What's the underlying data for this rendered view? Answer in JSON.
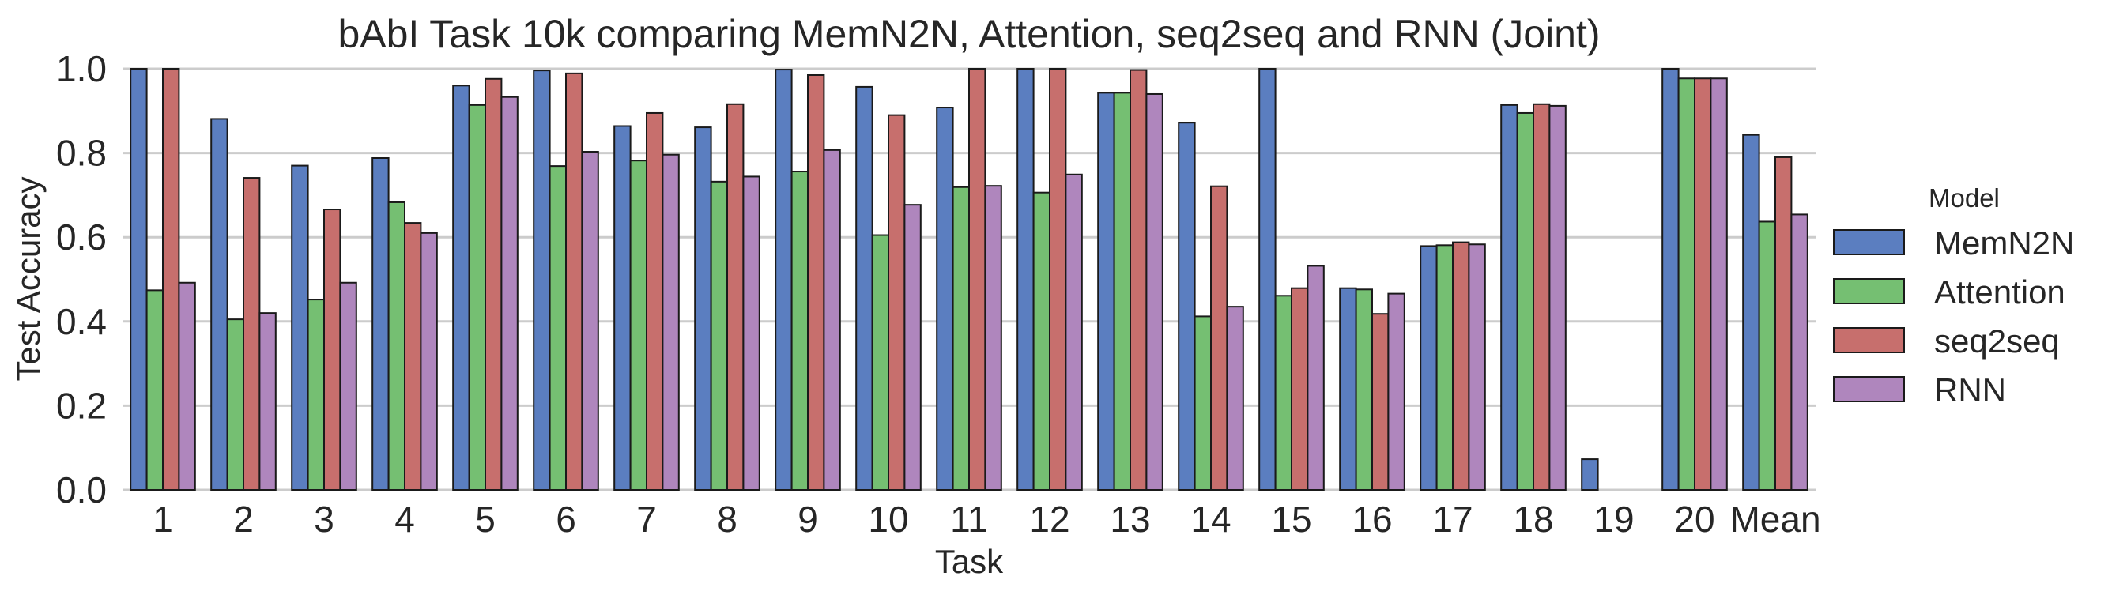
{
  "chart_data": {
    "type": "bar",
    "title": "bAbI Task 10k comparing MemN2N, Attention, seq2seq and RNN (Joint)",
    "xlabel": "Task",
    "ylabel": "Test Accuracy",
    "ylim": [
      0.0,
      1.0
    ],
    "yticks": [
      "0.0",
      "0.2",
      "0.4",
      "0.6",
      "0.8",
      "1.0"
    ],
    "grid": true,
    "legend": {
      "title": "Model",
      "placement": "right"
    },
    "categories": [
      "1",
      "2",
      "3",
      "4",
      "5",
      "6",
      "7",
      "8",
      "9",
      "10",
      "11",
      "12",
      "13",
      "14",
      "15",
      "16",
      "17",
      "18",
      "19",
      "20",
      "Mean"
    ],
    "series": [
      {
        "name": "MemN2N",
        "color": "#5b7ec0",
        "values": [
          1.0,
          0.881,
          0.77,
          0.788,
          0.96,
          0.996,
          0.864,
          0.861,
          0.998,
          0.957,
          0.908,
          1.0,
          0.943,
          0.872,
          1.0,
          0.479,
          0.579,
          0.914,
          0.073,
          1.0,
          0.843
        ]
      },
      {
        "name": "Attention",
        "color": "#75bf72",
        "values": [
          0.474,
          0.405,
          0.452,
          0.683,
          0.914,
          0.769,
          0.782,
          0.732,
          0.756,
          0.605,
          0.719,
          0.706,
          0.943,
          0.412,
          0.461,
          0.476,
          0.581,
          0.895,
          0.0,
          0.977,
          0.637
        ]
      },
      {
        "name": "seq2seq",
        "color": "#c76f6d",
        "values": [
          1.0,
          0.741,
          0.666,
          0.634,
          0.976,
          0.989,
          0.895,
          0.916,
          0.985,
          0.89,
          1.0,
          1.0,
          0.997,
          0.721,
          0.479,
          0.418,
          0.588,
          0.916,
          0.0,
          0.977,
          0.79
        ]
      },
      {
        "name": "RNN",
        "color": "#af86bd",
        "values": [
          0.492,
          0.42,
          0.492,
          0.61,
          0.933,
          0.803,
          0.796,
          0.744,
          0.807,
          0.677,
          0.722,
          0.749,
          0.94,
          0.435,
          0.532,
          0.466,
          0.583,
          0.912,
          0.0,
          0.977,
          0.654
        ]
      }
    ]
  }
}
